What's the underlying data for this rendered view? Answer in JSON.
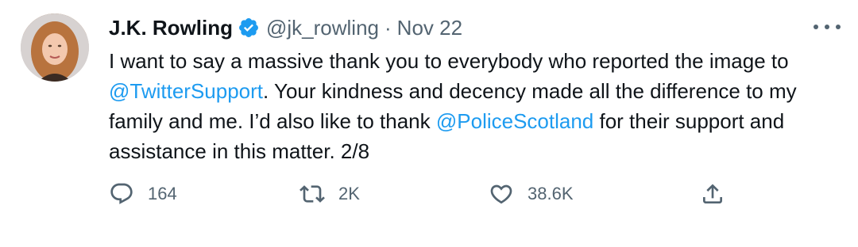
{
  "tweet": {
    "author_name": "J.K. Rowling",
    "handle": "@jk_rowling",
    "separator": "·",
    "date": "Nov 22",
    "text_parts": {
      "p1": "I want to say a massive thank you to everybody who reported the image to ",
      "mention1": "@TwitterSupport",
      "p2": ". Your kindness and decency made all the difference to my family and me. I’d also like to thank ",
      "mention2": "@PoliceScotland",
      "p3": " for their support and assistance in this matter. 2/8"
    },
    "icons": {
      "avatar": "profile-photo",
      "verified": "verified-badge-icon",
      "more": "more-options-icon",
      "reply": "reply-icon",
      "retweet": "retweet-icon",
      "like": "heart-icon",
      "share": "share-icon"
    },
    "counts": {
      "replies": "164",
      "retweets": "2K",
      "likes": "38.6K"
    },
    "colors": {
      "text": "#0f1419",
      "muted": "#536471",
      "accent": "#1d9bf0"
    }
  }
}
